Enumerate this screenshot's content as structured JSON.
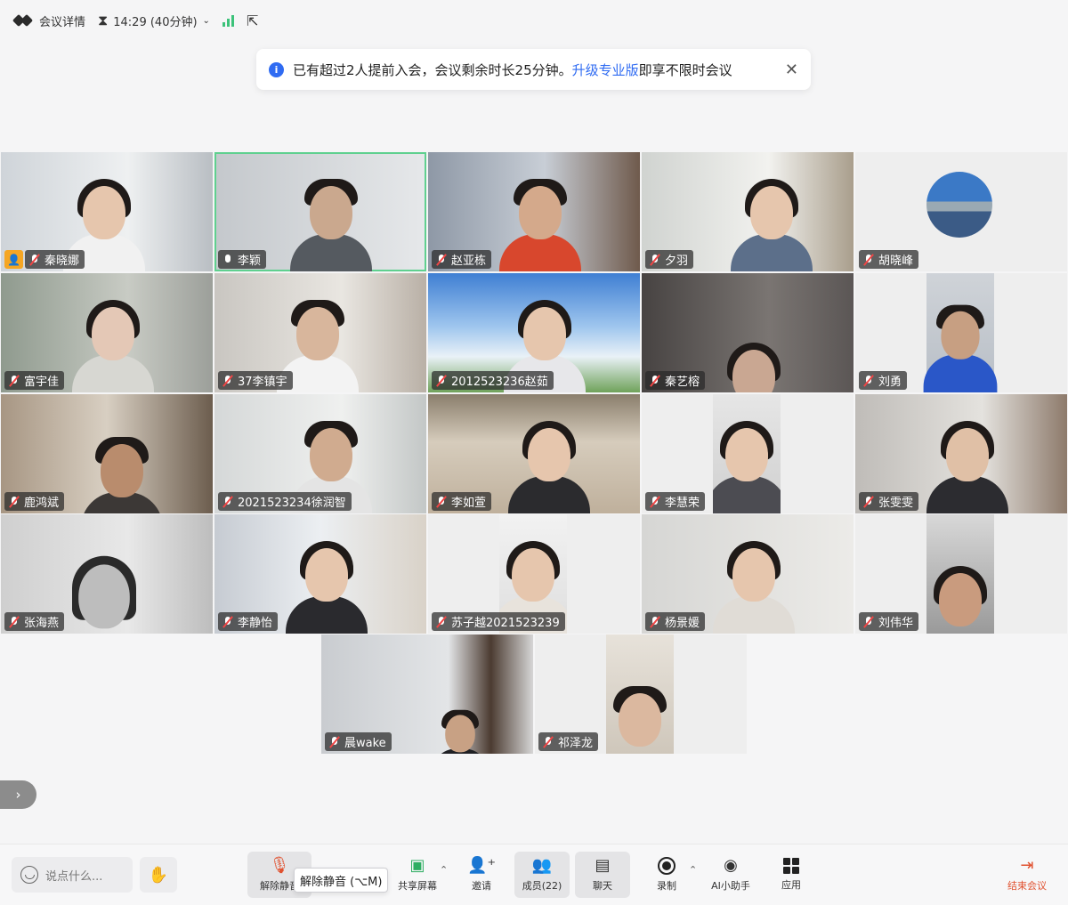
{
  "topbar": {
    "meeting_details": "会议详情",
    "time": "14:29 (40分钟)"
  },
  "notice": {
    "text_before": "已有超过2人提前入会，会议剩余时长25分钟。",
    "link": "升级专业版",
    "text_after": "即享不限时会议"
  },
  "participants": [
    {
      "name": "秦晓娜",
      "muted": true,
      "host": true
    },
    {
      "name": "李颖",
      "muted": false,
      "active_speaker": true
    },
    {
      "name": "赵亚栋",
      "muted": true
    },
    {
      "name": "夕羽",
      "muted": true
    },
    {
      "name": "胡晓峰",
      "muted": true,
      "avatar_only": true
    },
    {
      "name": "富宇佳",
      "muted": true
    },
    {
      "name": "37李镇宇",
      "muted": true
    },
    {
      "name": "2012523236赵茹",
      "muted": true
    },
    {
      "name": "秦艺榕",
      "muted": true
    },
    {
      "name": "刘勇",
      "muted": true
    },
    {
      "name": "鹿鸿斌",
      "muted": true
    },
    {
      "name": "2021523234徐润智",
      "muted": true
    },
    {
      "name": "李如萱",
      "muted": true
    },
    {
      "name": "李慧荣",
      "muted": true
    },
    {
      "name": "张雯雯",
      "muted": true
    },
    {
      "name": "张海燕",
      "muted": true
    },
    {
      "name": "李静怡",
      "muted": true
    },
    {
      "name": "苏子越2021523239",
      "muted": true
    },
    {
      "name": "杨景媛",
      "muted": true
    },
    {
      "name": "刘伟华",
      "muted": true
    },
    {
      "name": "晨wake",
      "muted": true
    },
    {
      "name": "祁泽龙",
      "muted": true
    }
  ],
  "toolbar": {
    "chat_placeholder": "说点什么...",
    "unmute": "解除静音",
    "tooltip": "解除静音 (⌥M)",
    "share": "共享屏幕",
    "invite": "邀请",
    "members": "成员(22)",
    "chat": "聊天",
    "record": "录制",
    "ai": "AI小助手",
    "apps": "应用",
    "end": "结束会议"
  }
}
